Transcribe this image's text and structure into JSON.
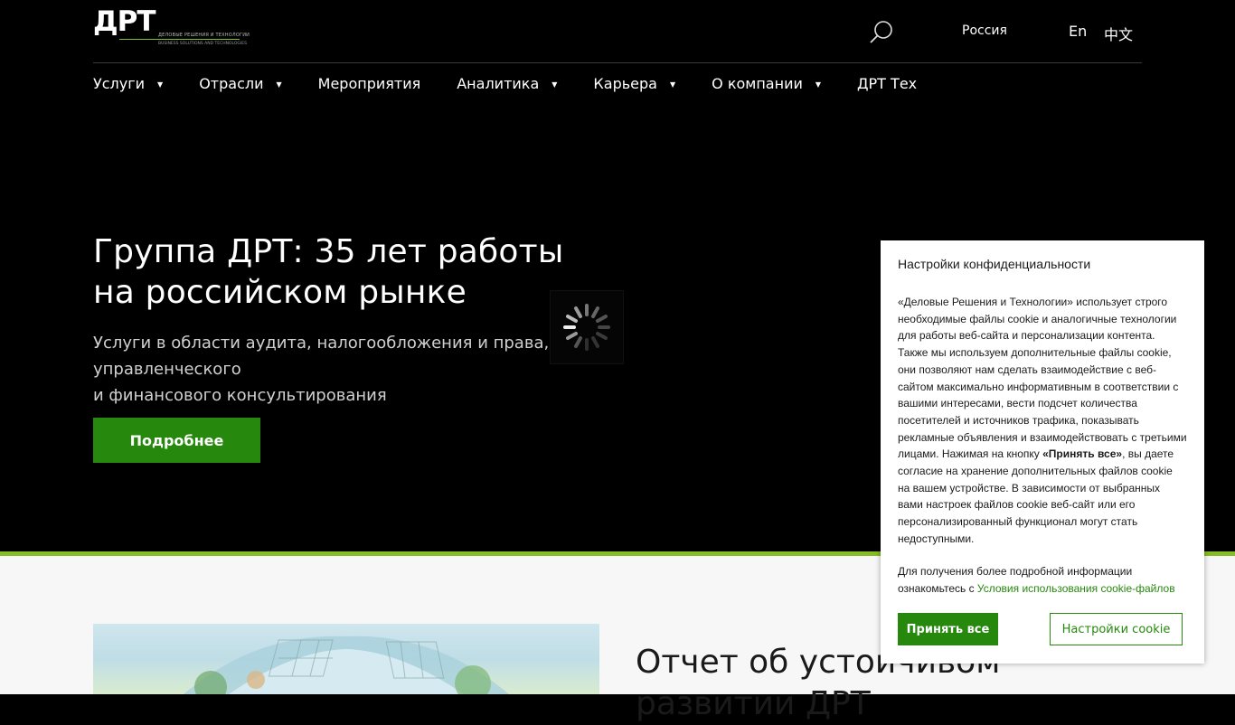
{
  "header": {
    "logo_text": "ДРТ",
    "logo_tagline_ru": "ДЕЛОВЫЕ РЕШЕНИЯ И ТЕХНОЛОГИИ",
    "logo_tagline_en": "BUSINESS SOLUTIONS AND TECHNOLOGIES",
    "search_icon": "search-icon",
    "region_label": "Россия",
    "lang_en": "En",
    "lang_zh": "中文"
  },
  "nav": {
    "items": [
      {
        "label": "Услуги",
        "has_dropdown": true
      },
      {
        "label": "Отрасли",
        "has_dropdown": true
      },
      {
        "label": "Мероприятия",
        "has_dropdown": false
      },
      {
        "label": "Аналитика",
        "has_dropdown": true
      },
      {
        "label": "Карьера",
        "has_dropdown": true
      },
      {
        "label": "О компании",
        "has_dropdown": true
      },
      {
        "label": "ДРТ Тех",
        "has_dropdown": false
      }
    ],
    "caret_glyph": "▼"
  },
  "hero": {
    "title_line1": "Группа ДРТ: 35 лет работы",
    "title_line2": "на российском рынке",
    "subtitle_line1": "Услуги в области аудита, налогообложения и права, управленческого",
    "subtitle_line2": "и финансового консультирования",
    "button_label": "Подробнее"
  },
  "report": {
    "title": "Отчет об устойчивом развитии ДРТ"
  },
  "cookie": {
    "title": "Настройки конфиденциальности",
    "body_before_bold": "«Деловые Решения и Технологии» использует строго необходимые файлы cookie и аналогичные технологии для работы веб-сайта и персонализации контента. Также мы используем дополнительные файлы cookie, они позволяют нам сделать взаимодействие с веб-сайтом максимально информативным в соответствии с вашими интересами, вести подсчет количества посетителей и источников трафика, показывать рекламные объявления и взаимодействовать с третьими лицами. Нажимая на кнопку ",
    "body_bold": "«Принять все»",
    "body_after_bold": ", вы даете согласие на хранение дополнительных файлов cookie на вашем устройстве. В зависимости от выбранных вами настроек файлов cookie веб-сайт или его персонализированный функционал могут стать недоступными.",
    "more_text": "Для получения более подробной информации ознакомьтесь с ",
    "more_link": "Условия использования cookie-файлов",
    "accept_label": "Принять все",
    "settings_label": "Настройки cookie"
  },
  "colors": {
    "brand_green": "#26890d",
    "accent_lime": "#86bc25",
    "hero_bg": "#000000"
  }
}
